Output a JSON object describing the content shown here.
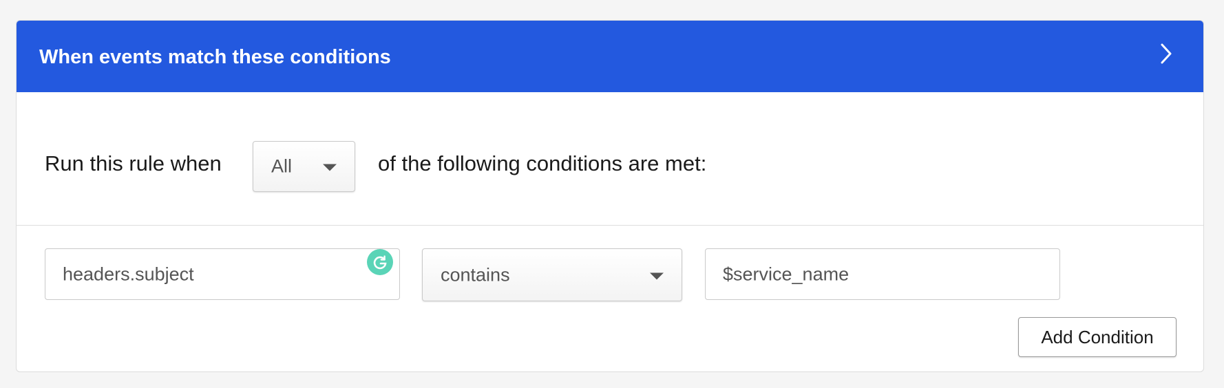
{
  "header": {
    "title": "When events match these conditions",
    "expand_icon": "chevron-right-icon"
  },
  "rule": {
    "prefix": "Run this rule when",
    "match_value": "All",
    "suffix": "of the following conditions are met:"
  },
  "condition": {
    "field_value": "headers.subject",
    "operator_value": "contains",
    "value": "$service_name",
    "grammarly_icon": "grammarly-g-icon"
  },
  "actions": {
    "add_condition_label": "Add Condition"
  },
  "colors": {
    "header_bg": "#2359df",
    "header_text": "#ffffff",
    "grammarly": "#15c39a"
  }
}
